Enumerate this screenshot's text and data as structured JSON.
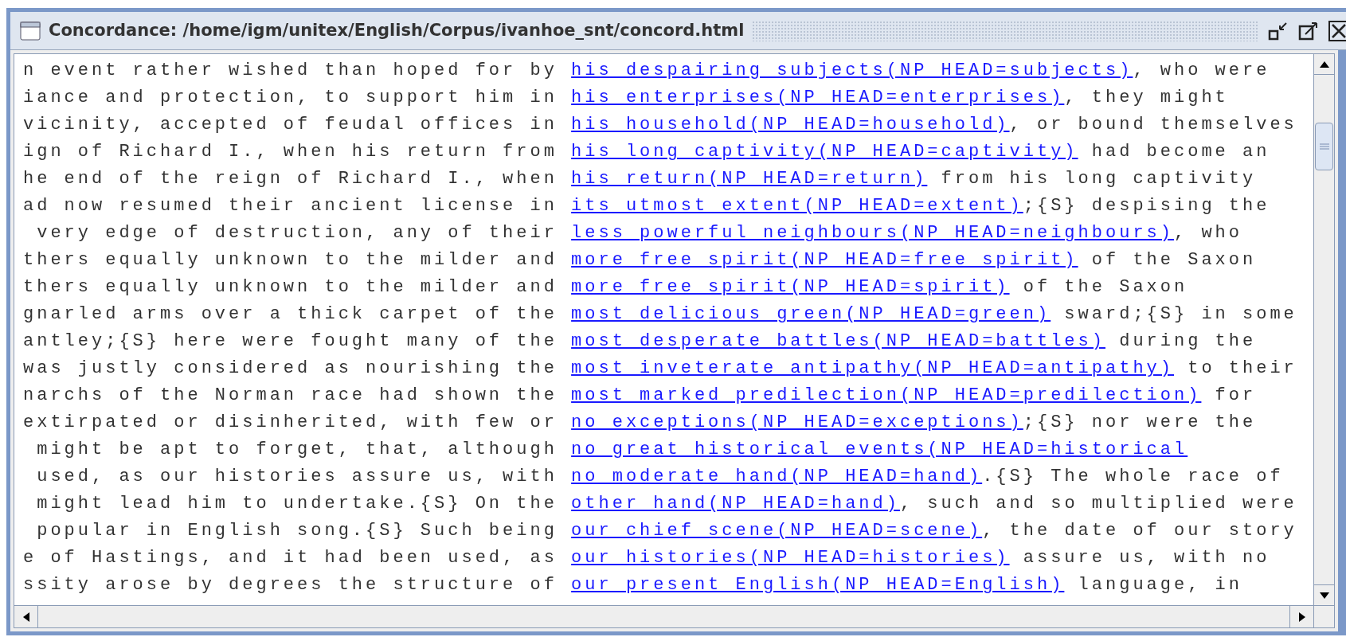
{
  "window": {
    "title": "Concordance: /home/igm/unitex/English/Corpus/ivanhoe_snt/concord.html"
  },
  "lines": [
    {
      "left": "n event rather wished than hoped for by ",
      "match": "his despairing subjects(NP HEAD=subjects)",
      "right": ", who were"
    },
    {
      "left": "iance and protection, to support him in ",
      "match": "his enterprises(NP HEAD=enterprises)",
      "right": ", they might"
    },
    {
      "left": "vicinity, accepted of feudal offices in ",
      "match": "his household(NP HEAD=household)",
      "right": ", or bound themselves"
    },
    {
      "left": "ign of Richard I., when his return from ",
      "match": "his long captivity(NP HEAD=captivity)",
      "right": " had become an"
    },
    {
      "left": "he end of the reign of Richard I., when ",
      "match": "his return(NP HEAD=return)",
      "right": " from his long captivity"
    },
    {
      "left": "ad now resumed their ancient license in ",
      "match": "its utmost extent(NP HEAD=extent)",
      "right": ";{S} despising the"
    },
    {
      "left": " very edge of destruction, any of their ",
      "match": "less powerful neighbours(NP HEAD=neighbours)",
      "right": ", who"
    },
    {
      "left": "thers equally unknown to the milder and ",
      "match": "more free spirit(NP HEAD=free spirit)",
      "right": " of the Saxon"
    },
    {
      "left": "thers equally unknown to the milder and ",
      "match": "more free spirit(NP HEAD=spirit)",
      "right": " of the Saxon"
    },
    {
      "left": "gnarled arms over a thick carpet of the ",
      "match": "most delicious green(NP HEAD=green)",
      "right": " sward;{S} in some"
    },
    {
      "left": "antley;{S} here were fought many of the ",
      "match": "most desperate battles(NP HEAD=battles)",
      "right": " during the"
    },
    {
      "left": "was justly considered as nourishing the ",
      "match": "most inveterate antipathy(NP HEAD=antipathy)",
      "right": " to their"
    },
    {
      "left": "narchs of the Norman race had shown the ",
      "match": "most marked predilection(NP HEAD=predilection)",
      "right": " for"
    },
    {
      "left": "extirpated or disinherited, with few or ",
      "match": "no exceptions(NP HEAD=exceptions)",
      "right": ";{S} nor were the"
    },
    {
      "left": " might be apt to forget, that, although ",
      "match": "no great historical events(NP HEAD=historical"
    },
    {
      "left": " used, as our histories assure us, with ",
      "match": "no moderate hand(NP HEAD=hand)",
      "right": ".{S} The whole race of"
    },
    {
      "left": " might lead him to undertake.{S} On the ",
      "match": "other hand(NP HEAD=hand)",
      "right": ", such and so multiplied were"
    },
    {
      "left": " popular in English song.{S} Such being ",
      "match": "our chief scene(NP HEAD=scene)",
      "right": ", the date of our story"
    },
    {
      "left": "e of Hastings, and it had been used, as ",
      "match": "our histories(NP HEAD=histories)",
      "right": " assure us, with no"
    },
    {
      "left": "ssity arose by degrees the structure of ",
      "match": "our present English(NP HEAD=English)",
      "right": " language, in"
    }
  ]
}
